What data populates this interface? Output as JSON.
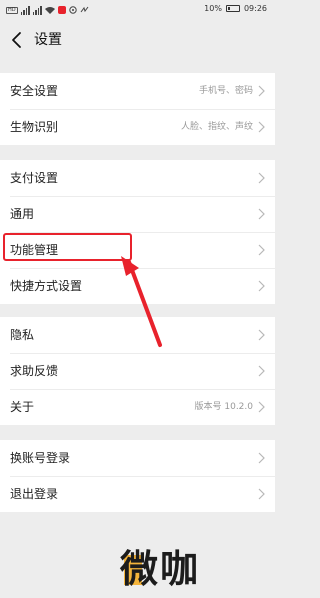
{
  "status_bar": {
    "left_icons": [
      "hd-icon",
      "signal-4g-icon",
      "signal-icon",
      "wifi-icon",
      "app-notification-icon",
      "location-icon",
      "nfc-icon"
    ],
    "battery": "10%",
    "time": "09:26"
  },
  "header": {
    "title": "设置"
  },
  "groups": [
    {
      "items": [
        {
          "label": "安全设置",
          "value": "手机号、密码"
        },
        {
          "label": "生物识别",
          "value": "人脸、指纹、声纹"
        }
      ]
    },
    {
      "items": [
        {
          "label": "支付设置",
          "value": ""
        },
        {
          "label": "通用",
          "value": ""
        },
        {
          "label": "功能管理",
          "value": ""
        },
        {
          "label": "快捷方式设置",
          "value": ""
        }
      ]
    },
    {
      "items": [
        {
          "label": "隐私",
          "value": ""
        },
        {
          "label": "求助反馈",
          "value": ""
        },
        {
          "label": "关于",
          "value": "版本号 10.2.0"
        }
      ]
    },
    {
      "items": [
        {
          "label": "换账号登录",
          "value": ""
        },
        {
          "label": "退出登录",
          "value": ""
        }
      ]
    }
  ],
  "annotation": {
    "color": "#e8222c"
  },
  "watermark": {
    "text": "微咖",
    "accent": "#f4b43b"
  }
}
